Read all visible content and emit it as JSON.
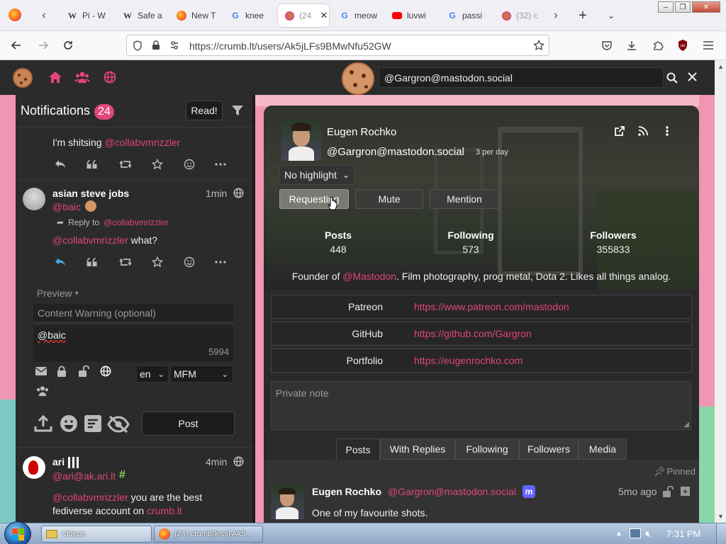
{
  "browser": {
    "tabs": [
      {
        "label": "Pi - W",
        "icon": "wikipedia-favicon"
      },
      {
        "label": "Safe a",
        "icon": "wikipedia-favicon"
      },
      {
        "label": "New T",
        "icon": "firefox-favicon"
      },
      {
        "label": "knee",
        "icon": "google-favicon"
      },
      {
        "label": "(24",
        "icon": "crumb-favicon"
      },
      {
        "label": "meow",
        "icon": "google-favicon"
      },
      {
        "label": "luvwi",
        "icon": "youtube-favicon"
      },
      {
        "label": "passi",
        "icon": "google-favicon"
      },
      {
        "label": "(32) c",
        "icon": "crumb-favicon"
      }
    ],
    "url": "https://crumb.lt/users/Ak5jLFs9BMwNfu52GW"
  },
  "header": {
    "search_value": "@Gargron@mastodon.social"
  },
  "notifications": {
    "title": "Notifications",
    "count": "24",
    "read_label": "Read!",
    "first_text": "I'm shitsing",
    "first_mention": "@collabvmrizzler",
    "post2": {
      "author": "asian steve jobs",
      "time": "1min",
      "handle": "@baic",
      "reply_to_label": "Reply to",
      "reply_to_handle": "@collabvmrizzler",
      "mention": "@collabvmrizzler",
      "text": " what?"
    },
    "composer": {
      "preview_label": "Preview",
      "cw_placeholder": "Content Warning (optional)",
      "text": "@baic",
      "char_count": "5994",
      "language": "en",
      "format": "MFM",
      "post_label": "Post"
    },
    "post3": {
      "author": "ari",
      "time": "4min",
      "handle": "@ari@ak.ari.lt",
      "mention": "@collabvmrizzler",
      "text1": " you are the best",
      "text2": "fediverse account on ",
      "link": "crumb.lt"
    }
  },
  "profile": {
    "name": "Eugen Rochko",
    "handle": "@Gargron@mastodon.social",
    "rate": "3 per day",
    "highlight_label": "No highlight",
    "buttons": {
      "requesting": "Requesting",
      "mute": "Mute",
      "mention": "Mention"
    },
    "stats": [
      {
        "label": "Posts",
        "value": "448"
      },
      {
        "label": "Following",
        "value": "573"
      },
      {
        "label": "Followers",
        "value": "355833"
      }
    ],
    "bio_prefix": "Founder of ",
    "bio_link": "@Mastodon",
    "bio_rest": ". Film photography, prog metal, Dota 2. Likes all things analog.",
    "fields": [
      {
        "name": "Patreon",
        "value": "https://www.patreon.com/mastodon"
      },
      {
        "name": "GitHub",
        "value": "https://github.com/Gargron"
      },
      {
        "name": "Portfolio",
        "value": "https://eugenrochko.com"
      }
    ],
    "note_placeholder": "Private note",
    "tabs": [
      "Posts",
      "With Replies",
      "Following",
      "Followers",
      "Media"
    ],
    "pinned_label": "Pinned",
    "post": {
      "author": "Eugen Rochko",
      "handle": "@Gargron@mastodon.social",
      "time": "5mo ago",
      "text": "One of my favourite shots."
    }
  },
  "taskbar": {
    "items": [
      {
        "label": "Videos"
      },
      {
        "label": "(24) crumb[less] Ak5..."
      }
    ],
    "clock": "7:31 PM"
  },
  "colors": {
    "accent": "#e0457b",
    "pink_bg": "#ee96b2",
    "panel": "#2b2b2b"
  }
}
